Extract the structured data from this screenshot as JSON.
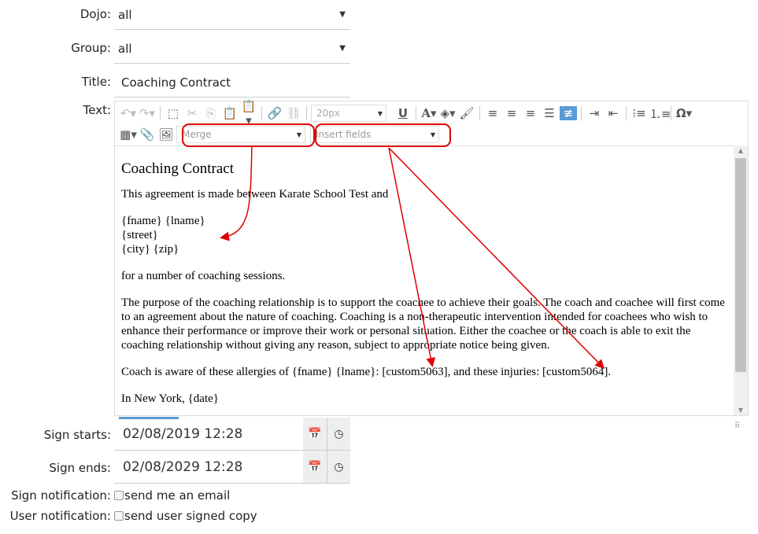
{
  "form": {
    "dojo": {
      "label": "Dojo:",
      "value": "all"
    },
    "group": {
      "label": "Group:",
      "value": "all"
    },
    "title": {
      "label": "Title:",
      "value": "Coaching Contract"
    },
    "text": {
      "label": "Text:"
    },
    "sign_starts": {
      "label": "Sign starts:",
      "value": "02/08/2019 12:28"
    },
    "sign_ends": {
      "label": "Sign ends:",
      "value": "02/08/2029 12:28"
    },
    "sign_notification": {
      "label": "Sign notification:",
      "option": "send me an email",
      "checked": false
    },
    "user_notification": {
      "label": "User notification:",
      "option": "send user signed copy",
      "checked": false
    }
  },
  "toolbar": {
    "font_size": "20px",
    "merge_placeholder": "Merge",
    "insert_fields_placeholder": "Insert fields",
    "active_color": "#5b9bd5"
  },
  "document": {
    "heading": "Coaching Contract",
    "p1": "This agreement is made between Karate School Test and",
    "addr1": "{fname} {lname}",
    "addr2": "{street}",
    "addr3": "{city} {zip}",
    "p2": "for a number of coaching sessions.",
    "p3": "The purpose of the coaching relationship is to support the coachee to achieve their goals. The coach and coachee will first come to an agreement about the nature of coaching. Coaching is a non-therapeutic intervention intended for coachees who wish to enhance their performance or improve their work or personal situation. Either the coachee or the coach is able to exit the coaching relationship without giving any reason, subject to appropriate notice being given.",
    "p4": "Coach is aware of these allergies of {fname} {lname}: [custom5063], and these injuries: [custom5064].",
    "p5": "In New York, {date}"
  },
  "annotation_color": "#e00000"
}
